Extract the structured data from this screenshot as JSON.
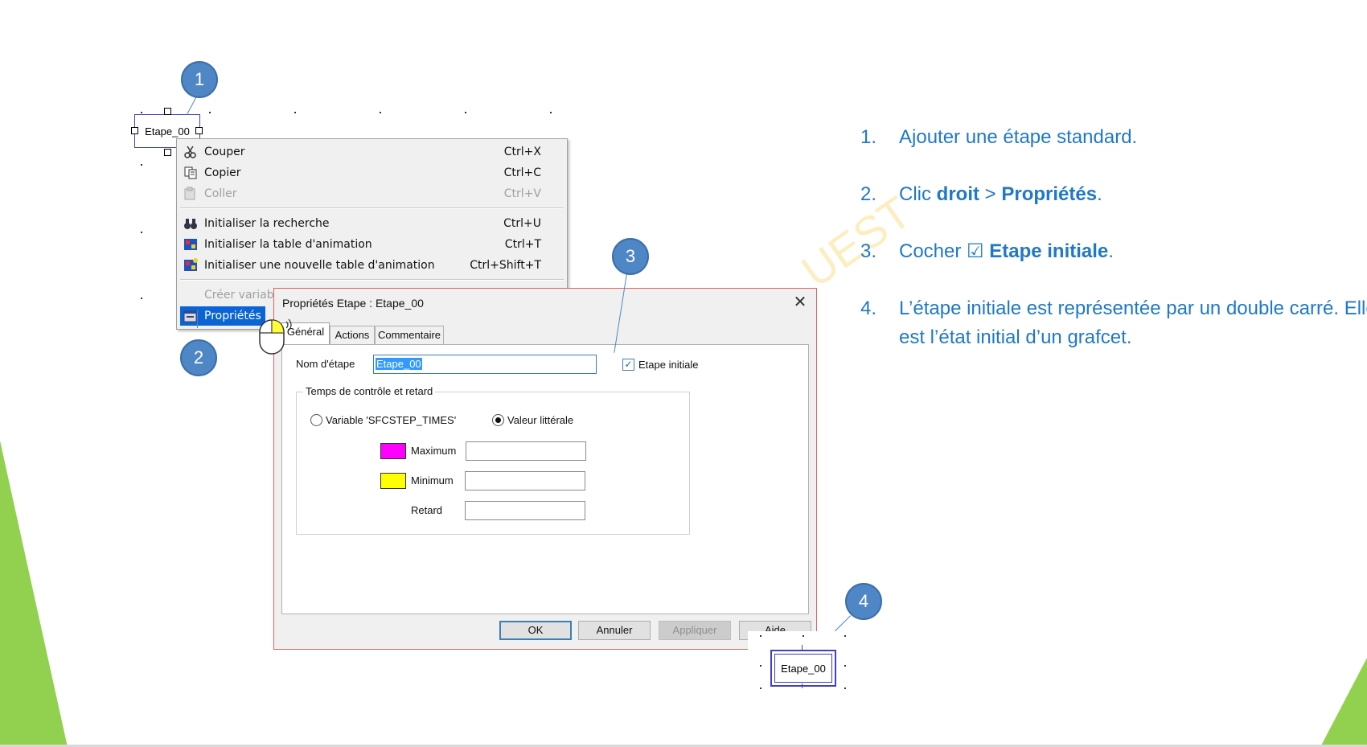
{
  "canvas": {
    "step_label": "Etape_00"
  },
  "context_menu": {
    "items": [
      {
        "label": "Couper",
        "shortcut": "Ctrl+X",
        "icon": "scissors-icon",
        "state": "enabled"
      },
      {
        "label": "Copier",
        "shortcut": "Ctrl+C",
        "icon": "copy-icon",
        "state": "enabled"
      },
      {
        "label": "Coller",
        "shortcut": "Ctrl+V",
        "icon": "paste-icon",
        "state": "disabled"
      },
      {
        "label": "Initialiser la recherche",
        "shortcut": "Ctrl+U",
        "icon": "binoculars-icon",
        "state": "enabled"
      },
      {
        "label": "Initialiser la table d'animation",
        "shortcut": "Ctrl+T",
        "icon": "animation-table-icon",
        "state": "enabled"
      },
      {
        "label": "Initialiser une nouvelle table d'animation",
        "shortcut": "Ctrl+Shift+T",
        "icon": "new-animation-table-icon",
        "state": "enabled"
      },
      {
        "label": "Créer variabl",
        "shortcut": "",
        "icon": "",
        "state": "disabled"
      },
      {
        "label": "Propriétés",
        "shortcut": "",
        "icon": "properties-icon",
        "state": "selected"
      }
    ]
  },
  "dialog": {
    "title": "Propriétés Etape : Etape_00",
    "tabs": [
      "Général",
      "Actions",
      "Commentaire"
    ],
    "active_tab": "Général",
    "step_name_label": "Nom d'étape",
    "step_name_value": "Etape_00",
    "initial_step_label": "Etape initiale",
    "initial_step_checked": true,
    "group_title": "Temps de contrôle et retard",
    "radio_variable": "Variable 'SFCSTEP_TIMES'",
    "radio_literal": "Valeur littérale",
    "radio_selected": "Valeur littérale",
    "maximum_label": "Maximum",
    "minimum_label": "Minimum",
    "delay_label": "Retard",
    "maximum_value": "",
    "minimum_value": "",
    "delay_value": "",
    "maximum_color": "#ff00ff",
    "minimum_color": "#ffff00",
    "buttons": {
      "ok": "OK",
      "cancel": "Annuler",
      "apply": "Appliquer",
      "help": "Aide"
    }
  },
  "callouts": [
    "1",
    "2",
    "3",
    "4"
  ],
  "instructions": [
    {
      "num": "1.",
      "parts": [
        {
          "text": "Ajouter une étape standard.",
          "bold": false
        }
      ]
    },
    {
      "num": "2.",
      "parts": [
        {
          "text": "Clic ",
          "bold": false
        },
        {
          "text": "droit",
          "bold": true
        },
        {
          "text": " > ",
          "bold": false
        },
        {
          "text": "Propriétés",
          "bold": true
        },
        {
          "text": ".",
          "bold": false
        }
      ]
    },
    {
      "num": "3.",
      "parts": [
        {
          "text": "Cocher ☑ ",
          "bold": false
        },
        {
          "text": "Etape initiale",
          "bold": true
        },
        {
          "text": ".",
          "bold": false
        }
      ]
    },
    {
      "num": "4.",
      "parts": [
        {
          "text": "L’étape initiale est représentée par un double carré. Elle est l’état initial d’un grafcet.",
          "bold": false
        }
      ]
    }
  ],
  "colors": {
    "accent_blue": "#1f78c8",
    "callout_blue": "#4f86c6",
    "slide_green": "#92d050",
    "menu_selection": "#0a64d6"
  }
}
